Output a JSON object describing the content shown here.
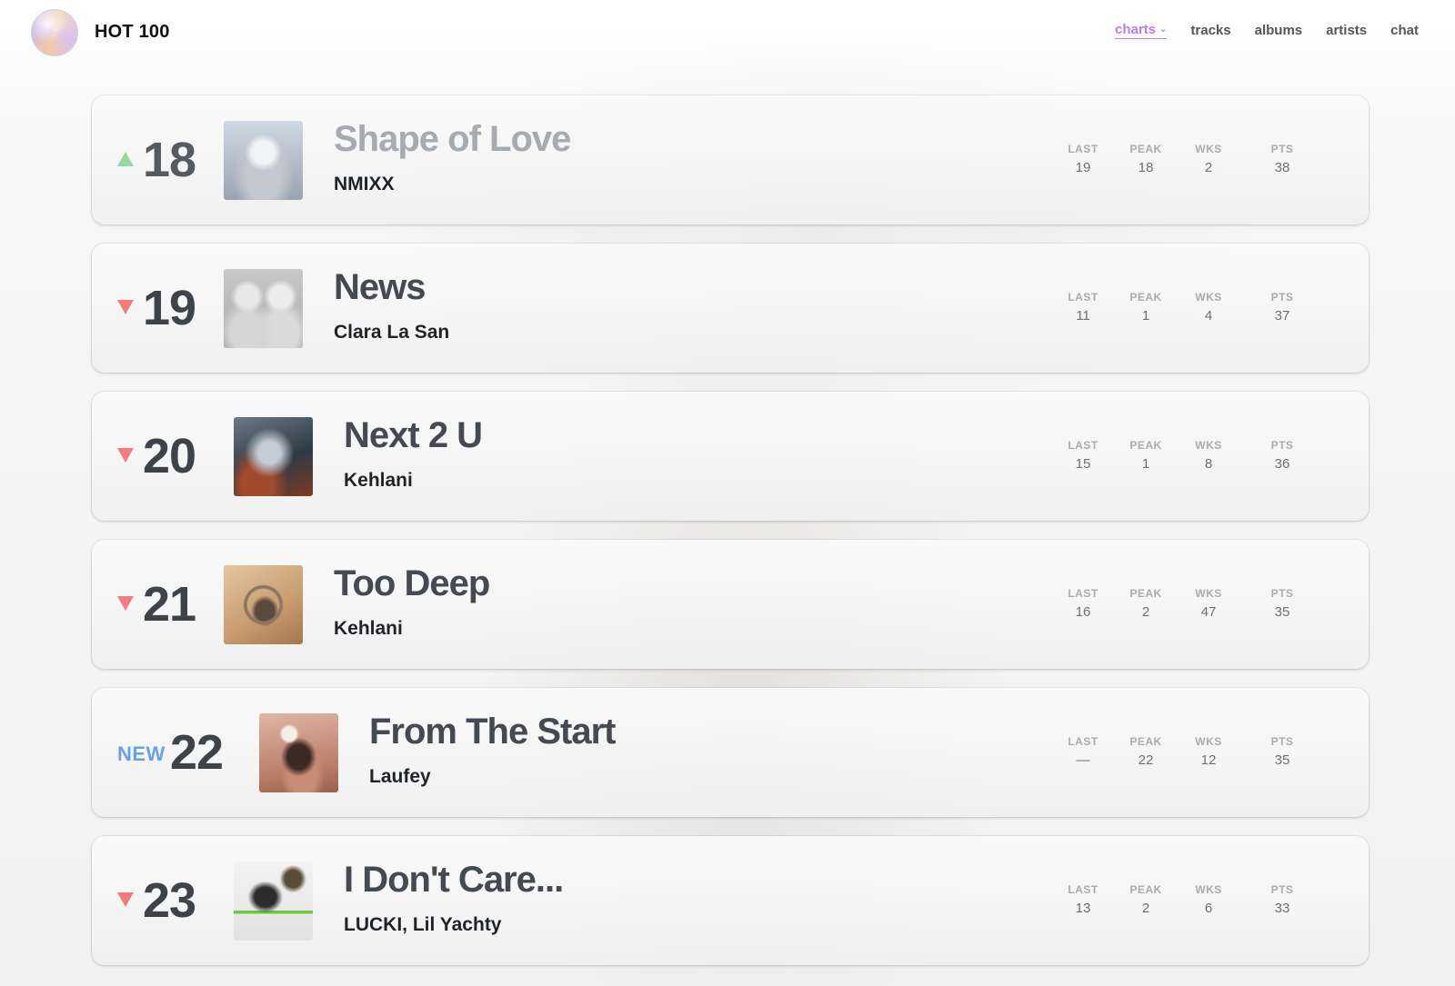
{
  "header": {
    "brand": "HOT 100",
    "nav": [
      {
        "label": "charts",
        "active": true
      },
      {
        "label": "tracks"
      },
      {
        "label": "albums"
      },
      {
        "label": "artists"
      },
      {
        "label": "chat"
      }
    ]
  },
  "stat_labels": {
    "last": "LAST",
    "peak": "PEAK",
    "wks": "WKS",
    "pts": "PTS"
  },
  "colors": {
    "up": "#96d7a4",
    "down": "#f27c7c",
    "new": "#6aa0e6",
    "accent": "#b97ee0"
  },
  "chart": [
    {
      "trend": "up",
      "rank": "18",
      "title": "Shape of Love",
      "artist": "NMIXX",
      "last": "19",
      "peak": "18",
      "wks": "2",
      "pts": "38",
      "cover_icon": "album-cover-shape-of-love"
    },
    {
      "trend": "down",
      "rank": "19",
      "title": "News",
      "artist": "Clara La San",
      "last": "11",
      "peak": "1",
      "wks": "4",
      "pts": "37",
      "cover_icon": "album-cover-news"
    },
    {
      "trend": "down",
      "rank": "20",
      "title": "Next 2 U",
      "artist": "Kehlani",
      "last": "15",
      "peak": "1",
      "wks": "8",
      "pts": "36",
      "cover_icon": "album-cover-next-2-u"
    },
    {
      "trend": "down",
      "rank": "21",
      "title": "Too Deep",
      "artist": "Kehlani",
      "last": "16",
      "peak": "2",
      "wks": "47",
      "pts": "35",
      "cover_icon": "album-cover-too-deep"
    },
    {
      "trend": "new",
      "new_label": "NEW",
      "rank": "22",
      "title": "From The Start",
      "artist": "Laufey",
      "last": "—",
      "peak": "22",
      "wks": "12",
      "pts": "35",
      "cover_icon": "album-cover-from-the-start"
    },
    {
      "trend": "down",
      "rank": "23",
      "title": "I Don't Care...",
      "artist": "LUCKI, Lil Yachty",
      "last": "13",
      "peak": "2",
      "wks": "6",
      "pts": "33",
      "cover_icon": "album-cover-i-dont-care"
    }
  ]
}
